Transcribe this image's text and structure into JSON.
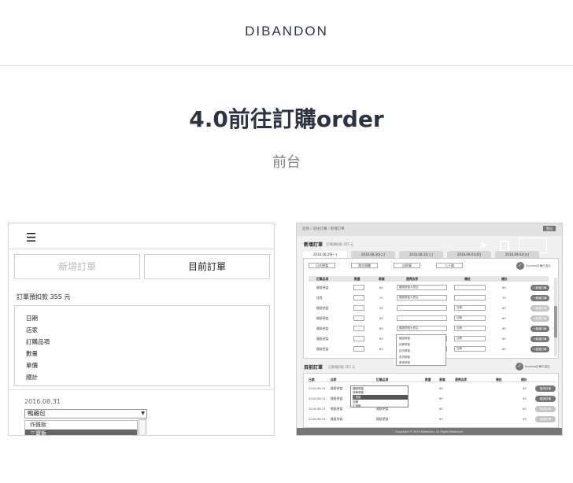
{
  "header": {
    "brand": "DIBANDON"
  },
  "main": {
    "title": "4.0前往訂購order",
    "subtitle": "前台"
  },
  "mobile_mockup": {
    "tabs": {
      "new_order": "新增訂單",
      "current_order": "目前訂單"
    },
    "deduction": "訂單預扣款 355 元",
    "fields": [
      "日期",
      "店家",
      "訂購品項",
      "數量",
      "單價",
      "總計"
    ],
    "date_value": "2016.08.31",
    "store_select": "鴨雞包",
    "dropdown_options": [
      "炸雞飯",
      "三寶飯"
    ]
  },
  "desktop_mockup": {
    "breadcrumb": "首頁 / 前往訂購 / 新增訂單",
    "logout": "登出",
    "new_order_title": "新增訂單",
    "new_order_note": "訂單預扣款 355 元",
    "tabs": [
      "2016.08.29(一)",
      "2016.08.30(二)",
      "2016.08.31(三)",
      "2016.09.01(四)",
      "2016.09.02(五)"
    ],
    "filters": [
      "日式便當",
      "港式燒臘",
      "自助餐",
      "三十路"
    ],
    "status": "Success訂單已送出",
    "columns": [
      "訂購品項",
      "數量",
      "單價",
      "選擇店家",
      "備註",
      "總計"
    ],
    "rows": [
      {
        "item": "雞腿便當",
        "price": "65",
        "store": "雞腿便當大賣店",
        "note": "",
        "total": "65",
        "btn": "+新增訂單",
        "dim": false
      },
      {
        "item": "排骨",
        "price": "70",
        "store": "雞腿便當大賣店",
        "note": "",
        "total": "70",
        "btn": "+新增訂單",
        "dim": false
      },
      {
        "item": "雞腿便當",
        "price": "65",
        "store": "",
        "note": "加辣",
        "total": "65",
        "btn": "+新增訂單",
        "dim": true
      },
      {
        "item": "雞腿便當",
        "price": "65",
        "store": "",
        "note": "加辣",
        "total": "65",
        "btn": "+新增訂單",
        "dim": true
      },
      {
        "item": "雞腿便當",
        "price": "65",
        "store": "雞腿便當大賣店",
        "note": "加辣",
        "total": "65",
        "btn": "+新增訂單",
        "dim": false
      },
      {
        "item": "雞腿便當",
        "price": "65",
        "store": "雞腿便當大賣店",
        "note": "加辣",
        "total": "65",
        "btn": "+新增訂單",
        "dim": false
      },
      {
        "item": "雞腿便當",
        "price": "65",
        "store": "雞腿便當大賣店",
        "note": "加辣",
        "total": "65",
        "btn": "+新增訂單",
        "dim": false
      }
    ],
    "dropdown_items": [
      "雞腿便當",
      "排骨便當",
      "控肉便當",
      "魚排便當",
      "素食便當"
    ],
    "current_title": "目前訂單",
    "current_note": "訂單預扣款 355 元",
    "columns2": [
      "日期",
      "店家",
      "訂購品項",
      "數量",
      "單價",
      "選擇店家",
      "備註",
      "總計"
    ],
    "rows2": [
      {
        "date": "2016.08.31",
        "store": "雞腿便當",
        "item": "雞腿便當",
        "price": "65",
        "total": "65",
        "btn": "取消訂單",
        "dim": false
      },
      {
        "date": "2016.08.31",
        "store": "雞腿便當",
        "item": "雞腿便當",
        "price": "65",
        "total": "65",
        "btn": "取消訂單",
        "dim": false
      },
      {
        "date": "2016.08.31",
        "store": "雞腿便當",
        "item": "雞腿便當",
        "price": "65",
        "total": "65",
        "btn": "取消訂單",
        "dim": true
      },
      {
        "date": "2016.08.31",
        "store": "雞腿便當",
        "item": "雞腿便當",
        "price": "65",
        "total": "65",
        "btn": "取消訂單",
        "dim": true
      }
    ],
    "dropdown2_items": [
      "雞腿便當",
      "排骨便當",
      "三寶飯",
      "加辣",
      "正常飯"
    ],
    "footer": "Copyright © 2016 Dibandon. All Rights Reserved."
  }
}
